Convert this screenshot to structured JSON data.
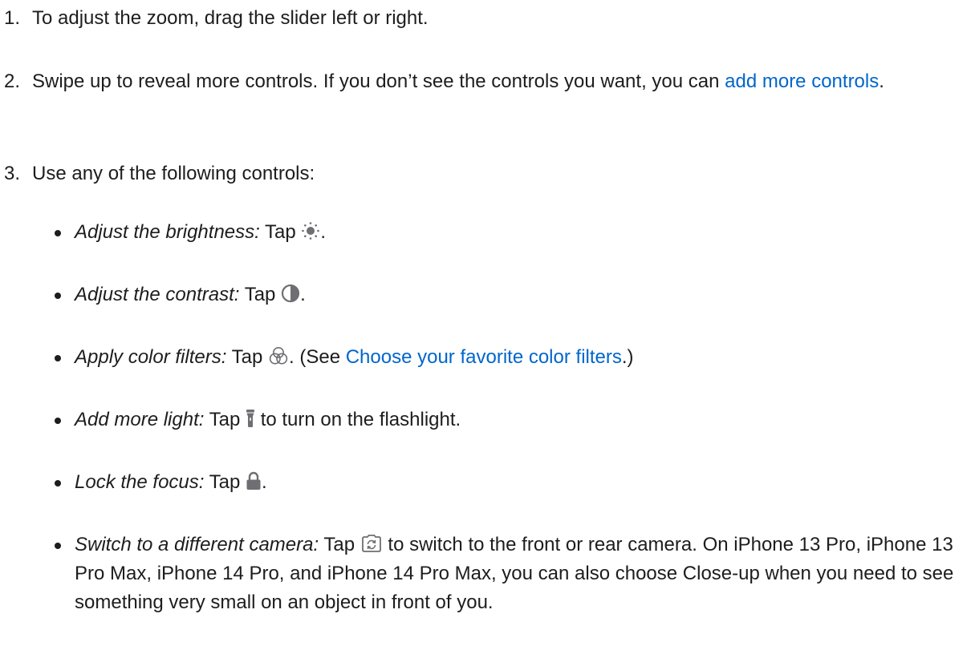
{
  "steps": [
    {
      "number": "1.",
      "text": "To adjust the zoom, drag the slider left or right."
    },
    {
      "number": "2.",
      "text_before": "Swipe up to reveal more controls. If you don’t see the controls you want, you can ",
      "link": "add more controls",
      "text_after": "."
    },
    {
      "number": "3.",
      "text": "Use any of the following controls:"
    }
  ],
  "controls": [
    {
      "label": "Adjust the brightness:",
      "tap": " Tap ",
      "icon": "brightness-icon",
      "after": "."
    },
    {
      "label": "Adjust the contrast:",
      "tap": " Tap ",
      "icon": "contrast-icon",
      "after": "."
    },
    {
      "label": "Apply color filters:",
      "tap": " Tap ",
      "icon": "color-filters-icon",
      "after": ". (See ",
      "link": "Choose your favorite color filters",
      "after_link": ".)"
    },
    {
      "label": "Add more light:",
      "tap": " Tap ",
      "icon": "flashlight-icon",
      "after": " to turn on the flashlight."
    },
    {
      "label": "Lock the focus:",
      "tap": " Tap ",
      "icon": "lock-icon",
      "after": "."
    },
    {
      "label": "Switch to a different camera:",
      "tap": " Tap ",
      "icon": "switch-camera-icon",
      "after": " to switch to the front or rear camera. On iPhone 13 Pro, iPhone 13 Pro Max, iPhone 14 Pro, and iPhone 14 Pro Max, you can also choose Close-up when you need to see something very small on an object in front of you."
    }
  ],
  "colors": {
    "text": "#1d1d1f",
    "link": "#0066cc",
    "icon": "#6e6e73"
  }
}
